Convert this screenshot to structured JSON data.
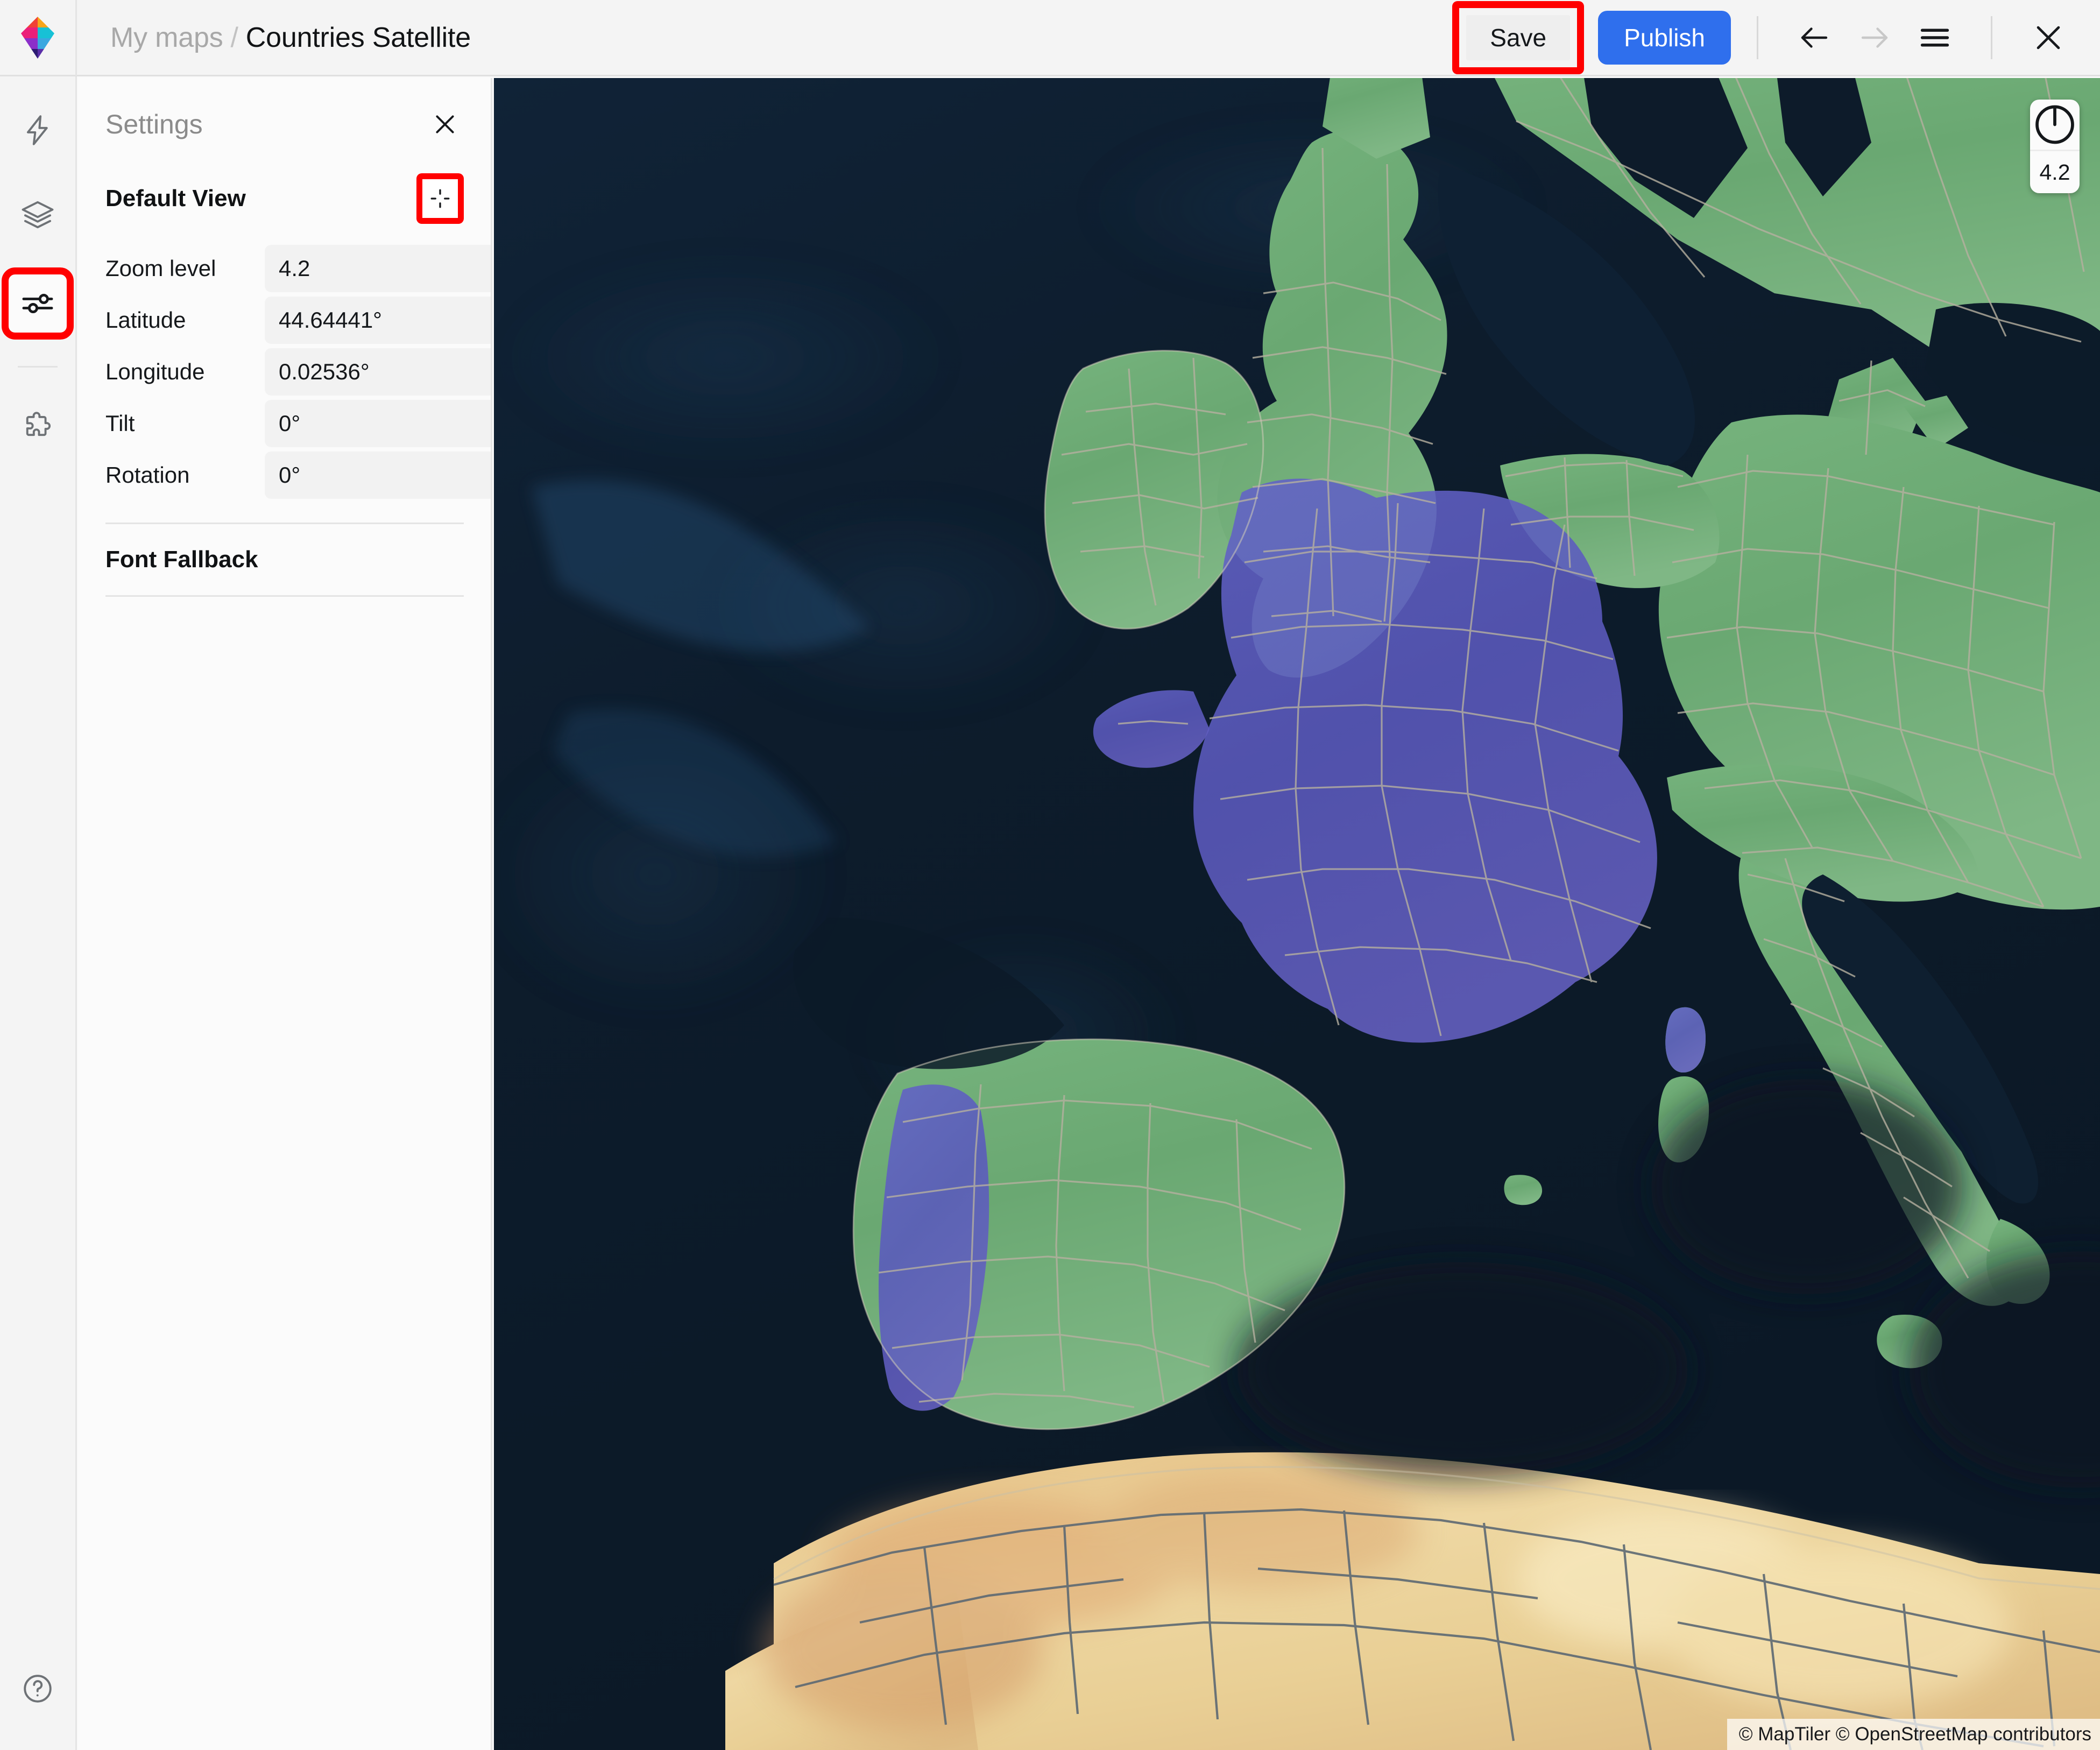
{
  "header": {
    "logo_icon": "maptiler-pin-logo",
    "breadcrumb": {
      "root": "My maps",
      "separator": "/",
      "current": "Countries Satellite"
    },
    "save_label": "Save",
    "publish_label": "Publish",
    "back_icon": "arrow-left-icon",
    "forward_icon": "arrow-right-icon",
    "menu_icon": "hamburger-menu-icon",
    "close_icon": "close-icon",
    "publish_color": "#2f6fed",
    "highlight_color": "#ff0000"
  },
  "rail": {
    "items": [
      {
        "icon": "lightning-bolt-icon",
        "name": "quick-actions",
        "active": false
      },
      {
        "icon": "layers-icon",
        "name": "layers",
        "active": false
      },
      {
        "icon": "sliders-settings-icon",
        "name": "settings",
        "active": true
      },
      {
        "icon": "puzzle-piece-icon",
        "name": "plugins",
        "active": false
      }
    ],
    "help_icon": "help-circle-icon"
  },
  "panel": {
    "title": "Settings",
    "close_icon": "close-icon",
    "section": {
      "title": "Default View",
      "crosshair_icon": "crosshair-target-icon"
    },
    "fields": [
      {
        "label": "Zoom level",
        "value": "4.2"
      },
      {
        "label": "Latitude",
        "value": "44.64441°"
      },
      {
        "label": "Longitude",
        "value": "0.02536°"
      },
      {
        "label": "Tilt",
        "value": "0°"
      },
      {
        "label": "Rotation",
        "value": "0°"
      }
    ],
    "font_fallback_title": "Font Fallback"
  },
  "map": {
    "zoom_widget": {
      "compass_icon": "compass-needle-icon",
      "zoom_value": "4.2"
    },
    "attribution": "© MapTiler © OpenStreetMap contributors",
    "colors": {
      "ocean_deep": "#0d1b2a",
      "ocean_shelf": "#16304a",
      "land_green": "#6aaa73",
      "land_green_light": "#86bd8a",
      "highlight_purple": "#5a5ac0",
      "desert_sand": "#e3c48d",
      "desert_light": "#eedfae",
      "border_line": "#b3ae9e",
      "border_line_dark": "#5a6670"
    },
    "view": {
      "center_lat": "44.64441°",
      "center_lon": "0.02536°",
      "zoom": "4.2",
      "tilt": "0°",
      "rotation": "0°"
    }
  }
}
